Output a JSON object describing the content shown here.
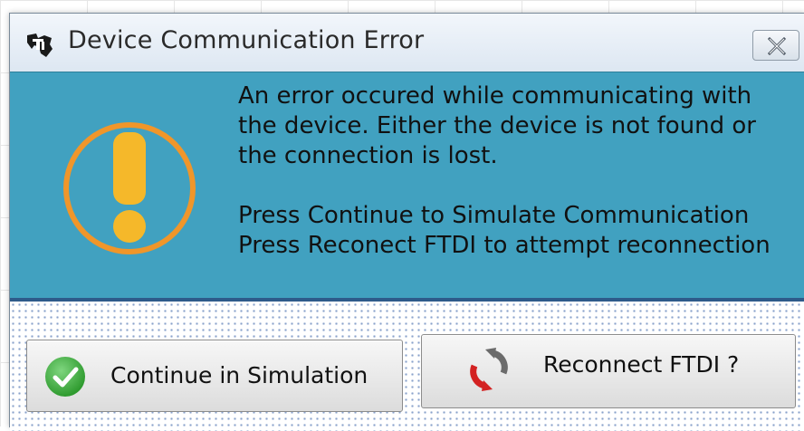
{
  "window": {
    "title": "Device Communication Error",
    "logo_icon": "ti-logo-icon",
    "close_icon": "close-icon"
  },
  "message": {
    "icon": "warning-exclamation-icon",
    "lines": [
      "An error occured while communicating with",
      "the device. Either the device is not found or",
      "the connection is lost."
    ],
    "hint_lines": [
      "Press Continue to Simulate Communication",
      "Press Reconect FTDI to attempt reconnection"
    ]
  },
  "buttons": {
    "continue": {
      "label": "Continue in Simulation",
      "icon": "green-check-icon"
    },
    "reconnect": {
      "label": "Reconnect FTDI ?",
      "icon": "refresh-arrows-icon"
    }
  },
  "colors": {
    "message_panel": "#41a1c0",
    "warning_ring": "#f0962a",
    "warning_fill": "#f5b82a",
    "check_green": "#3aaa3a",
    "reconnect_red": "#d32222",
    "reconnect_gray": "#6b6b6b"
  }
}
